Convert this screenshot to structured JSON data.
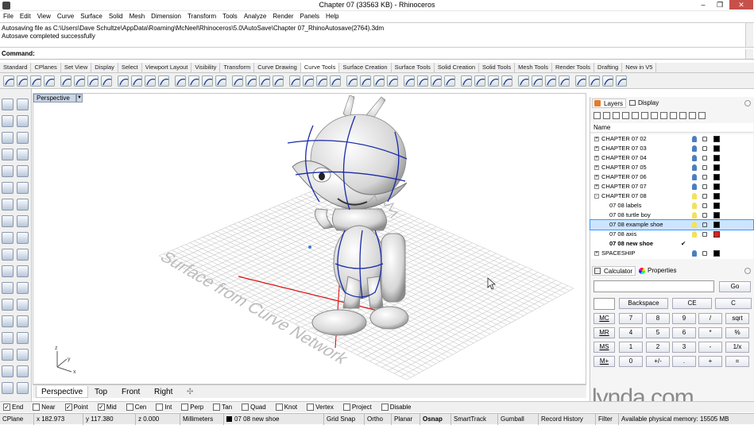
{
  "window": {
    "title": "Chapter 07 (33563 KB) - Rhinoceros"
  },
  "menu": [
    "File",
    "Edit",
    "View",
    "Curve",
    "Surface",
    "Solid",
    "Mesh",
    "Dimension",
    "Transform",
    "Tools",
    "Analyze",
    "Render",
    "Panels",
    "Help"
  ],
  "history": {
    "line1": "Autosaving file as C:\\Users\\Dave Schultze\\AppData\\Roaming\\McNeel\\Rhinoceros\\5.0\\AutoSave\\Chapter 07_RhinoAutosave(2764).3dm",
    "line2": "Autosave completed successfully"
  },
  "command": {
    "label": "Command:"
  },
  "toolbar_tabs": [
    "Standard",
    "CPlanes",
    "Set View",
    "Display",
    "Select",
    "Viewport Layout",
    "Visibility",
    "Transform",
    "Curve Drawing",
    "Curve Tools",
    "Surface Creation",
    "Surface Tools",
    "Solid Creation",
    "Solid Tools",
    "Mesh Tools",
    "Render Tools",
    "Drafting",
    "New in V5"
  ],
  "viewport": {
    "title": "Perspective",
    "annotation": "Surface from Curve Network",
    "axis_x": "x",
    "axis_y": "y",
    "axis_z": "z"
  },
  "viewport_tabs": [
    "Perspective",
    "Top",
    "Front",
    "Right"
  ],
  "panel": {
    "tab_layers": "Layers",
    "tab_display": "Display",
    "col_name": "Name",
    "layers": [
      {
        "name": "CHAPTER 07 02",
        "expander": "+",
        "bold": false,
        "selected": false,
        "bulb": "#4a7fc0",
        "swatch": "#000000"
      },
      {
        "name": "CHAPTER 07 03",
        "expander": "+",
        "bold": false,
        "selected": false,
        "bulb": "#4a7fc0",
        "swatch": "#000000"
      },
      {
        "name": "CHAPTER 07 04",
        "expander": "+",
        "bold": false,
        "selected": false,
        "bulb": "#4a7fc0",
        "swatch": "#000000"
      },
      {
        "name": "CHAPTER 07 05",
        "expander": "+",
        "bold": false,
        "selected": false,
        "bulb": "#4a7fc0",
        "swatch": "#000000"
      },
      {
        "name": "CHAPTER 07 06",
        "expander": "+",
        "bold": false,
        "selected": false,
        "bulb": "#4a7fc0",
        "swatch": "#000000"
      },
      {
        "name": "CHAPTER 07 07",
        "expander": "+",
        "bold": false,
        "selected": false,
        "bulb": "#4a7fc0",
        "swatch": "#000000"
      },
      {
        "name": "CHAPTER 07 08",
        "expander": "-",
        "bold": false,
        "selected": false,
        "bulb": "#f2e25a",
        "swatch": "#000000"
      },
      {
        "name": "07 08 labels",
        "expander": "",
        "bold": false,
        "selected": false,
        "bulb": "#f2e25a",
        "swatch": "#000000"
      },
      {
        "name": "07 08 turtle boy",
        "expander": "",
        "bold": false,
        "selected": false,
        "bulb": "#f2e25a",
        "swatch": "#000000"
      },
      {
        "name": "07 08 example shoe",
        "expander": "",
        "bold": false,
        "selected": true,
        "bulb": "#f2e25a",
        "swatch": "#000000"
      },
      {
        "name": "07 08 axis",
        "expander": "",
        "bold": false,
        "selected": false,
        "bulb": "#f2e25a",
        "swatch": "#e02020"
      },
      {
        "name": "07 08 new shoe",
        "expander": "",
        "bold": true,
        "selected": false,
        "bulb": "",
        "swatch": "",
        "check": "✔"
      },
      {
        "name": "SPACESHIP",
        "expander": "+",
        "bold": false,
        "selected": false,
        "bulb": "#4a7fc0",
        "swatch": "#000000"
      }
    ],
    "tab_calculator": "Calculator",
    "tab_properties": "Properties",
    "calc": {
      "go": "Go",
      "backspace": "Backspace",
      "ce": "CE",
      "c": "C",
      "rows": [
        [
          "MC",
          "7",
          "8",
          "9",
          "/",
          "sqrt"
        ],
        [
          "MR",
          "4",
          "5",
          "6",
          "*",
          "%"
        ],
        [
          "MS",
          "1",
          "2",
          "3",
          "-",
          "1/x"
        ],
        [
          "M+",
          "0",
          "+/-",
          ".",
          "+",
          "="
        ]
      ]
    }
  },
  "osnap": [
    {
      "label": "End",
      "checked": true
    },
    {
      "label": "Near",
      "checked": false
    },
    {
      "label": "Point",
      "checked": true
    },
    {
      "label": "Mid",
      "checked": true
    },
    {
      "label": "Cen",
      "checked": false
    },
    {
      "label": "Int",
      "checked": false
    },
    {
      "label": "Perp",
      "checked": false
    },
    {
      "label": "Tan",
      "checked": false
    },
    {
      "label": "Quad",
      "checked": false
    },
    {
      "label": "Knot",
      "checked": false
    },
    {
      "label": "Vertex",
      "checked": false
    },
    {
      "label": "Project",
      "checked": false
    },
    {
      "label": "Disable",
      "checked": false
    }
  ],
  "status": {
    "cplane": "CPlane",
    "x": "x 182.973",
    "y": "y 117.380",
    "z": "z 0.000",
    "units": "Millimeters",
    "layer": "07 08 new shoe",
    "grid_snap": "Grid Snap",
    "ortho": "Ortho",
    "planar": "Planar",
    "osnap": "Osnap",
    "smarttrack": "SmartTrack",
    "gumball": "Gumball",
    "record_history": "Record History",
    "filter": "Filter",
    "memory": "Available physical memory: 15505 MB"
  },
  "watermark": "lynda.com",
  "colors": {
    "accent_blue": "#3399ff",
    "selected_row": "#cce4ff",
    "curve_blue": "#1a2aa8",
    "axis_red": "#dd1111"
  }
}
